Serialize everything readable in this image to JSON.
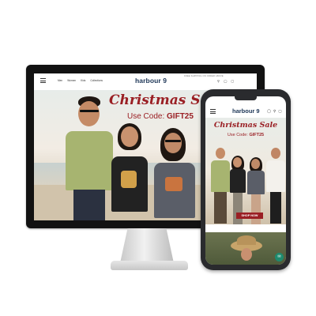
{
  "brand": {
    "logo_text": "harbour 9",
    "sale_color": "#9a1f24",
    "logo_color": "#1c3556"
  },
  "desktop": {
    "nav_links": [
      "Men",
      "Women",
      "Kids",
      "Collections"
    ],
    "top_note": "FREE SHIPPING ON ORDER ABOVE",
    "icons": [
      "search-icon",
      "user-icon",
      "cart-icon"
    ],
    "hero": {
      "title": "Christmas Sale",
      "code_label": "Use Code:",
      "code": "GIFT25"
    }
  },
  "mobile": {
    "icons": [
      "user-icon",
      "search-icon",
      "cart-icon"
    ],
    "hero": {
      "title": "Christmas Sale",
      "code_label": "Use Code:",
      "code": "GIFT25",
      "cta": "SHOP NOW"
    },
    "chat_icon": "chat-icon"
  }
}
